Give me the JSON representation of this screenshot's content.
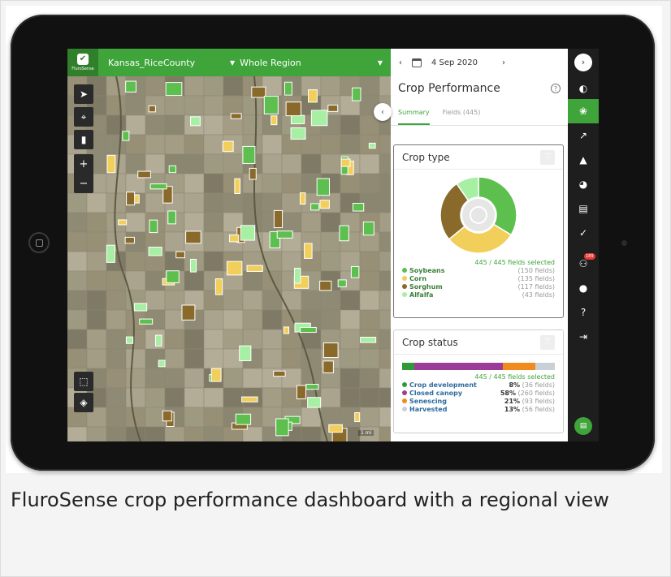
{
  "header": {
    "brand": "FluroSense",
    "region": "Kansas_RiceCounty",
    "view": "Whole Region"
  },
  "map": {
    "scale_label": "1 mi"
  },
  "panel": {
    "date": "4 Sep 2020",
    "title": "Crop Performance",
    "tabs": [
      {
        "label": "Summary",
        "active": true
      },
      {
        "label": "Fields (445)",
        "active": false
      }
    ],
    "crop_type": {
      "title": "Crop type",
      "selected": "445 / 445 fields selected",
      "items": [
        {
          "name": "Soybeans",
          "count": "(150 fields)",
          "color": "#5cbf4e",
          "value": 150
        },
        {
          "name": "Corn",
          "count": "(135 fields)",
          "color": "#f2cf5b",
          "value": 135
        },
        {
          "name": "Sorghum",
          "count": "(117 fields)",
          "color": "#8a6a2a",
          "value": 117
        },
        {
          "name": "Alfalfa",
          "count": "(43 fields)",
          "color": "#a6efa3",
          "value": 43
        }
      ]
    },
    "crop_status": {
      "title": "Crop status",
      "selected": "445 / 445 fields selected",
      "items": [
        {
          "name": "Crop development",
          "pct": "8%",
          "count": "(36 fields)",
          "color": "#2e9a3a",
          "value": 8
        },
        {
          "name": "Closed canopy",
          "pct": "58%",
          "count": "(260 fields)",
          "color": "#9b3d96",
          "value": 58
        },
        {
          "name": "Senescing",
          "pct": "21%",
          "count": "(93 fields)",
          "color": "#f28a1e",
          "value": 21
        },
        {
          "name": "Harvested",
          "pct": "13%",
          "count": "(56 fields)",
          "color": "#c9d1d6",
          "value": 13
        }
      ]
    }
  },
  "rail": {
    "badge": "189",
    "icons": [
      "layers-icon",
      "crop-icon",
      "chart-icon",
      "alert-icon",
      "pie-icon",
      "report-icon",
      "check-icon",
      "farmer-icon",
      "user-icon",
      "help-icon",
      "logout-icon"
    ]
  },
  "caption": "FluroSense crop performance dashboard with a regional view"
}
